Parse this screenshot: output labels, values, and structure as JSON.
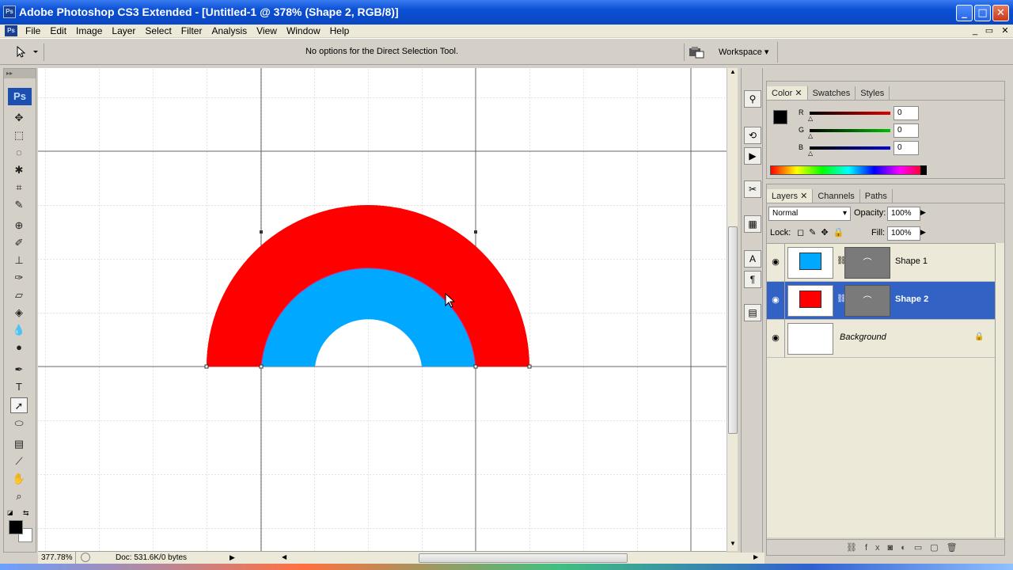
{
  "window": {
    "title": "Adobe Photoshop CS3 Extended - [Untitled-1 @ 378% (Shape 2, RGB/8)]",
    "app_icon": "Ps",
    "controls": {
      "minimize": "_",
      "maximize": "□",
      "close": "✕"
    }
  },
  "menubar": {
    "items": [
      "File",
      "Edit",
      "Image",
      "Layer",
      "Select",
      "Filter",
      "Analysis",
      "View",
      "Window",
      "Help"
    ],
    "mdi_controls": [
      "_",
      "▭",
      "✕"
    ]
  },
  "options_bar": {
    "message": "No options for the Direct Selection Tool.",
    "workspace_label": "Workspace ▾"
  },
  "toolbox": {
    "logo": "Ps",
    "header": "▸▸"
  },
  "canvas": {
    "outer_arc_color": "#ff0000",
    "inner_arc_color": "#00a8ff",
    "path_color": "#e0207a"
  },
  "status": {
    "zoom": "377.78%",
    "doc": "Doc: 531.6K/0 bytes"
  },
  "color_panel": {
    "tabs": [
      "Color",
      "Swatches",
      "Styles"
    ],
    "channels": [
      {
        "label": "R",
        "value": "0",
        "color": "#e00000"
      },
      {
        "label": "G",
        "value": "0",
        "color": "#00c000"
      },
      {
        "label": "B",
        "value": "0",
        "color": "#0000d0"
      }
    ]
  },
  "layers_panel": {
    "tabs": [
      "Layers",
      "Channels",
      "Paths"
    ],
    "blend_mode": "Normal",
    "opacity_label": "Opacity:",
    "opacity": "100%",
    "lock_label": "Lock:",
    "fill_label": "Fill:",
    "fill": "100%",
    "layers": [
      {
        "name": "Shape 1",
        "color": "#00a8ff",
        "selected": false
      },
      {
        "name": "Shape 2",
        "color": "#ff0000",
        "selected": true
      },
      {
        "name": "Background",
        "color": "#ffffff",
        "selected": false
      }
    ],
    "footer_icons": [
      "link-icon",
      "fx-icon",
      "mask-icon",
      "adjustment-icon",
      "group-icon",
      "new-layer-icon",
      "trash-icon"
    ]
  }
}
